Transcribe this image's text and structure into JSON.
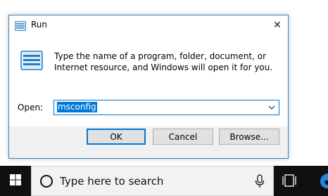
{
  "dialog": {
    "title": "Run",
    "description": "Type the name of a program, folder, document, or Internet resource, and Windows will open it for you.",
    "open_label": "Open:",
    "open_label_accesskey": "O",
    "open_value": "msconfig",
    "buttons": {
      "ok": "OK",
      "cancel": "Cancel",
      "browse": "Browse..."
    }
  },
  "taskbar": {
    "search_placeholder": "Type here to search"
  },
  "colors": {
    "accent": "#0078d7",
    "taskbar_bg": "#101010",
    "button_bar_bg": "#f0f0f0"
  },
  "icons": [
    "run-icon",
    "close-icon",
    "run-large-icon",
    "chevron-down-icon",
    "windows-logo-icon",
    "search-icon",
    "microphone-icon",
    "task-view-icon",
    "edge-icon"
  ]
}
